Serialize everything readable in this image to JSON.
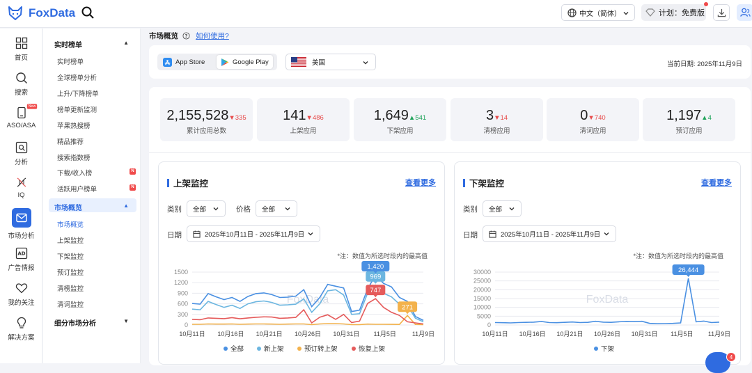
{
  "app": {
    "name": "FoxData"
  },
  "topbar": {
    "language": "中文（简体）",
    "plan": "计划：免费版",
    "message_count": "4"
  },
  "leftnav": [
    {
      "label": "首页",
      "icon": "dashboard-icon"
    },
    {
      "label": "搜索",
      "icon": "search-icon"
    },
    {
      "label": "ASO/ASA",
      "icon": "phone-icon",
      "badge": "New"
    },
    {
      "label": "分析",
      "icon": "analysis-icon"
    },
    {
      "label": "IQ",
      "icon": "dna-icon"
    },
    {
      "label": "市场分析",
      "icon": "mail-icon",
      "active": true
    },
    {
      "label": "广告情报",
      "icon": "ad-icon"
    },
    {
      "label": "我的关注",
      "icon": "heart-icon"
    },
    {
      "label": "解决方案",
      "icon": "bulb-icon"
    }
  ],
  "subnav": {
    "group1": {
      "title": "实时榜单",
      "items": [
        "实时榜单",
        "全球榜单分析",
        "上升/下降榜单",
        "榜单更新监测",
        "苹果热搜榜",
        "精品推荐",
        "搜索指数榜",
        "下载/收入榜",
        "活跃用户榜单"
      ]
    },
    "group2": {
      "title": "市场概览",
      "items": [
        "市场概览",
        "上架监控",
        "下架监控",
        "预订监控",
        "清榜监控",
        "清词监控"
      ]
    },
    "group3": {
      "title": "细分市场分析"
    },
    "badge": "N"
  },
  "breadcrumb": {
    "title": "市场概览",
    "help": "如何使用?"
  },
  "store_tabs": [
    "App Store",
    "Google Play"
  ],
  "country": "美国",
  "current_date": "当前日期: 2025年11月9日",
  "stats": [
    {
      "value": "2,155,528",
      "delta": "335",
      "dir": "down",
      "label": "累计应用总数"
    },
    {
      "value": "141",
      "delta": "486",
      "dir": "down",
      "label": "上架应用"
    },
    {
      "value": "1,649",
      "delta": "541",
      "dir": "up",
      "label": "下架应用"
    },
    {
      "value": "3",
      "delta": "14",
      "dir": "down",
      "label": "清榜应用"
    },
    {
      "value": "0",
      "delta": "740",
      "dir": "down",
      "label": "清词应用"
    },
    {
      "value": "1,197",
      "delta": "4",
      "dir": "up",
      "label": "预订应用"
    }
  ],
  "launch_panel": {
    "title": "上架监控",
    "more": "查看更多",
    "category_label": "类别",
    "category": "全部",
    "price_label": "价格",
    "price": "全部",
    "date_label": "日期",
    "date_range": "2025年10月11日 - 2025年11月9日",
    "note": "*注：数值为所选时段内的最高值"
  },
  "delist_panel": {
    "title": "下架监控",
    "more": "查看更多",
    "category_label": "类别",
    "category": "全部",
    "date_label": "日期",
    "date_range": "2025年10月11日 - 2025年11月9日",
    "note": "*注：数值为所选时段内的最高值"
  },
  "watermark": "FoxData",
  "chart_data": [
    {
      "type": "line",
      "title": "",
      "x_ticks": [
        "10月11日",
        "10月16日",
        "10月21日",
        "10月26日",
        "10月31日",
        "11月5日",
        "11月9日"
      ],
      "y_ticks": [
        "0",
        "300",
        "600",
        "900",
        "1200",
        "1500"
      ],
      "ylim": [
        0,
        1500
      ],
      "grid": true,
      "legend_position": "bottom",
      "series": [
        {
          "name": "全部",
          "color": "#4a90e2",
          "values": [
            610,
            590,
            890,
            800,
            720,
            780,
            670,
            810,
            890,
            910,
            860,
            780,
            790,
            820,
            1000,
            520,
            780,
            1150,
            1100,
            1050,
            380,
            420,
            1020,
            1420,
            1180,
            1080,
            780,
            670,
            240,
            130
          ]
        },
        {
          "name": "新上架",
          "color": "#6cb6e0",
          "values": [
            450,
            430,
            670,
            580,
            500,
            560,
            470,
            600,
            660,
            680,
            640,
            560,
            570,
            590,
            740,
            360,
            600,
            969,
            1000,
            850,
            300,
            320,
            900,
            1130,
            900,
            800,
            590,
            550,
            190,
            90
          ]
        },
        {
          "name": "预订转上架",
          "color": "#f3b24c",
          "values": [
            20,
            20,
            30,
            25,
            25,
            30,
            20,
            25,
            30,
            30,
            25,
            20,
            25,
            30,
            30,
            10,
            30,
            40,
            40,
            30,
            10,
            10,
            25,
            20,
            20,
            18,
            15,
            271,
            15,
            10
          ]
        },
        {
          "name": "恢复上架",
          "color": "#e55b5b",
          "values": [
            160,
            150,
            200,
            190,
            180,
            210,
            175,
            200,
            220,
            230,
            225,
            190,
            200,
            215,
            430,
            60,
            220,
            290,
            160,
            300,
            70,
            110,
            610,
            747,
            500,
            360,
            270,
            90,
            60,
            30
          ]
        }
      ],
      "labels": [
        {
          "value": "969",
          "series": "新上架"
        },
        {
          "value": "1,420",
          "series": "全部"
        },
        {
          "value": "747",
          "series": "恢复上架"
        },
        {
          "value": "271",
          "series": "预订转上架"
        }
      ]
    },
    {
      "type": "line",
      "title": "",
      "x_ticks": [
        "10月11日",
        "10月16日",
        "10月21日",
        "10月26日",
        "10月31日",
        "11月5日",
        "11月9日"
      ],
      "y_ticks": [
        "0",
        "5000",
        "10000",
        "15000",
        "20000",
        "25000",
        "30000"
      ],
      "ylim": [
        0,
        30000
      ],
      "grid": true,
      "legend_position": "bottom",
      "series": [
        {
          "name": "下架",
          "color": "#4a90e2",
          "values": [
            1400,
            1300,
            1200,
            1400,
            1500,
            1600,
            2000,
            1400,
            1300,
            1500,
            1700,
            1400,
            1500,
            2100,
            1600,
            1500,
            1800,
            2000,
            1900,
            2100,
            900,
            700,
            800,
            900,
            1200,
            26444,
            1800,
            2200,
            1400,
            1600
          ]
        }
      ],
      "labels": [
        {
          "value": "26,444",
          "series": "下架"
        }
      ]
    }
  ]
}
